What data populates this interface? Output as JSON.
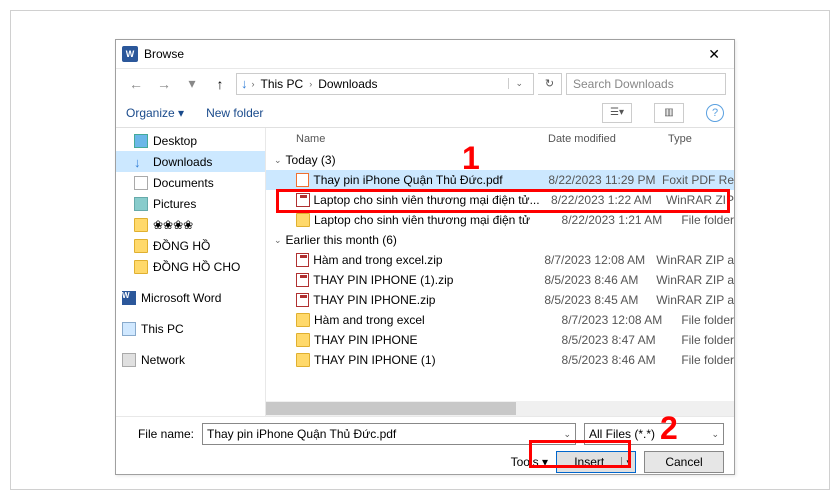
{
  "dialog": {
    "title": "Browse",
    "close_glyph": "✕"
  },
  "nav": {
    "back": "←",
    "forward": "→",
    "recent": "▾",
    "up": "↑",
    "refresh": "↻"
  },
  "address": {
    "root_icon": "↓",
    "seg1": "This PC",
    "seg2": "Downloads"
  },
  "search": {
    "placeholder": "Search Downloads",
    "icon": "🔍"
  },
  "toolbar": {
    "organize": "Organize ▾",
    "newfolder": "New folder",
    "help": "?"
  },
  "columns": {
    "name": "Name",
    "date": "Date modified",
    "type": "Type"
  },
  "sidebar": {
    "items": [
      {
        "label": "Desktop",
        "icon": "desktop"
      },
      {
        "label": "Downloads",
        "icon": "downloads",
        "selected": true
      },
      {
        "label": "Documents",
        "icon": "documents"
      },
      {
        "label": "Pictures",
        "icon": "pictures"
      },
      {
        "label": "❀❀❀❀",
        "icon": "folder"
      },
      {
        "label": "ĐỒNG HỒ",
        "icon": "folder"
      },
      {
        "label": "ĐỒNG HỒ CHO",
        "icon": "folder"
      },
      {
        "label": "Microsoft Word",
        "icon": "word",
        "gap": true
      },
      {
        "label": "This PC",
        "icon": "pc",
        "gap": true
      },
      {
        "label": "Network",
        "icon": "network",
        "gap": true
      }
    ]
  },
  "groups": [
    {
      "label": "Today (3)"
    },
    {
      "label": "Earlier this month (6)"
    }
  ],
  "files_today": [
    {
      "name": "Thay pin iPhone Quận Thủ Đức.pdf",
      "date": "8/22/2023 11:29 PM",
      "type": "Foxit PDF Re",
      "icon": "pdf",
      "selected": true
    },
    {
      "name": "Laptop cho sinh viên thương mại điện tử...",
      "date": "8/22/2023 1:22 AM",
      "type": "WinRAR ZIP",
      "icon": "zip"
    },
    {
      "name": "Laptop cho sinh viên thương mại điện tử",
      "date": "8/22/2023 1:21 AM",
      "type": "File folder",
      "icon": "folder"
    }
  ],
  "files_earlier": [
    {
      "name": "Hàm and trong excel.zip",
      "date": "8/7/2023 12:08 AM",
      "type": "WinRAR ZIP a",
      "icon": "zip"
    },
    {
      "name": "THAY PIN IPHONE (1).zip",
      "date": "8/5/2023 8:46 AM",
      "type": "WinRAR ZIP a",
      "icon": "zip"
    },
    {
      "name": "THAY PIN IPHONE.zip",
      "date": "8/5/2023 8:45 AM",
      "type": "WinRAR ZIP a",
      "icon": "zip"
    },
    {
      "name": "Hàm and trong excel",
      "date": "8/7/2023 12:08 AM",
      "type": "File folder",
      "icon": "folder"
    },
    {
      "name": "THAY PIN IPHONE",
      "date": "8/5/2023 8:47 AM",
      "type": "File folder",
      "icon": "folder"
    },
    {
      "name": "THAY PIN IPHONE (1)",
      "date": "8/5/2023 8:46 AM",
      "type": "File folder",
      "icon": "folder"
    }
  ],
  "footer": {
    "filename_label": "File name:",
    "filename_value": "Thay pin iPhone Quận Thủ Đức.pdf",
    "filter_value": "All Files (*.*)",
    "tools_label": "Tools  ▾",
    "insert_label": "Insert",
    "insert_dd": "▾",
    "cancel_label": "Cancel"
  },
  "annotations": {
    "num1": "1",
    "num2": "2"
  }
}
